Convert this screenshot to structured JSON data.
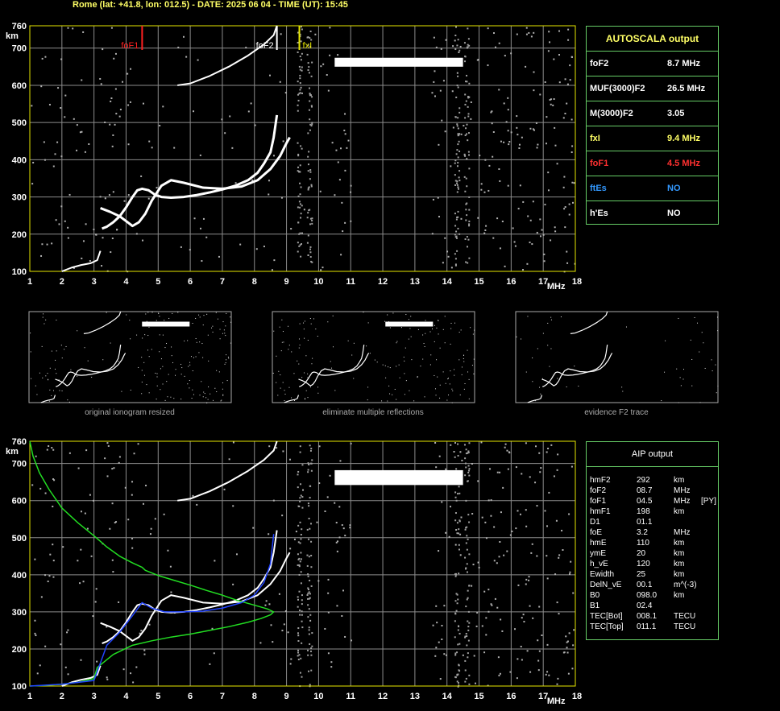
{
  "header": "Rome (lat: +41.8, lon: 012.5) - DATE: 2025 06 04 - TIME (UT): 15:45",
  "colors": {
    "axis": "#e6e600",
    "grid": "#8c8c8c",
    "trace": "#ffffff",
    "foF1_marker": "#ff2020",
    "fxI_marker": "#e6e600",
    "model_profile": "#22dd22",
    "aip_fit": "#2244ff",
    "label_yellow": "#ffff66",
    "label_red": "#ff3030",
    "label_blue": "#3399ff",
    "panel_border": "#66cc66"
  },
  "axes": {
    "ylabel": "km",
    "xlabel": "MHz",
    "x_ticks": [
      "1",
      "2",
      "3",
      "4",
      "5",
      "6",
      "7",
      "8",
      "9",
      "10",
      "11",
      "12",
      "13",
      "14",
      "15",
      "16",
      "17",
      "18"
    ],
    "y_ticks": [
      "100",
      "200",
      "300",
      "400",
      "500",
      "600",
      "700",
      "760"
    ]
  },
  "chart_data": [
    {
      "type": "scatter",
      "panel": "top-ionogram",
      "xlim": [
        1,
        18
      ],
      "ylim": [
        100,
        760
      ],
      "grid": true,
      "markers": [
        {
          "label": "foF1",
          "x": 4.5,
          "color": "#ff2020"
        },
        {
          "label": "foF2",
          "x": 8.7,
          "color": "#ffffff"
        },
        {
          "label": "fxI",
          "x": 9.4,
          "color": "#e6e600"
        }
      ],
      "series": [
        {
          "trace": "O-mode F2",
          "x": [
            3.25,
            3.4,
            3.6,
            3.8,
            4.0,
            4.2,
            4.35,
            4.5,
            4.7,
            4.9,
            5.1,
            5.4,
            5.8,
            6.2,
            6.6,
            7.0,
            7.4,
            7.8,
            8.1,
            8.3,
            8.5,
            8.6,
            8.7
          ],
          "y": [
            215,
            220,
            232,
            248,
            272,
            300,
            318,
            322,
            318,
            306,
            300,
            298,
            300,
            305,
            312,
            320,
            330,
            345,
            365,
            390,
            420,
            460,
            520
          ]
        },
        {
          "trace": "X-mode F2",
          "x": [
            3.2,
            3.5,
            3.8,
            4.0,
            4.2,
            4.4,
            4.6,
            4.8,
            5.1,
            5.4,
            5.8,
            6.4,
            7.0,
            7.6,
            8.1,
            8.5,
            8.8,
            9.0,
            9.1
          ],
          "y": [
            270,
            260,
            248,
            235,
            222,
            232,
            255,
            290,
            330,
            345,
            338,
            325,
            322,
            328,
            345,
            375,
            410,
            445,
            460
          ]
        },
        {
          "trace": "E-region",
          "x": [
            2.0,
            2.3,
            2.6,
            2.9,
            3.1,
            3.2
          ],
          "y": [
            100,
            110,
            117,
            122,
            130,
            155
          ]
        },
        {
          "trace": "multiple reflection",
          "x": [
            5.6,
            6.0,
            6.6,
            7.2,
            7.8,
            8.3,
            8.6,
            8.7
          ],
          "y": [
            600,
            605,
            625,
            650,
            680,
            710,
            735,
            760
          ]
        },
        {
          "trace": "sporadic band",
          "x": [
            10.5,
            14.5
          ],
          "y": [
            662,
            662
          ]
        }
      ]
    },
    {
      "type": "scatter",
      "panel": "bottom-ionogram-aip",
      "xlim": [
        1,
        18
      ],
      "ylim": [
        100,
        760
      ],
      "grid": true,
      "series": [
        {
          "trace": "model profile (green)",
          "x": [
            1.0,
            1.1,
            1.3,
            1.6,
            2.0,
            2.5,
            3.0,
            3.4,
            3.8,
            4.2,
            4.5,
            4.6,
            5.0,
            5.5,
            6.0,
            6.5,
            7.0,
            7.5,
            8.0,
            8.4,
            8.6,
            8.5,
            8.2,
            7.8,
            7.2,
            6.6,
            6.0,
            5.4,
            4.8,
            4.2,
            3.6,
            3.1,
            3.0,
            2.5,
            2.0,
            1.5,
            1.0
          ],
          "y": [
            760,
            720,
            675,
            630,
            580,
            540,
            505,
            475,
            450,
            432,
            420,
            412,
            398,
            385,
            372,
            358,
            345,
            330,
            318,
            308,
            300,
            292,
            282,
            272,
            260,
            250,
            240,
            232,
            222,
            210,
            185,
            150,
            120,
            110,
            105,
            102,
            100
          ]
        },
        {
          "trace": "AIP fit (blue)",
          "x": [
            1.0,
            2.0,
            3.0,
            3.4,
            3.8,
            4.2,
            4.5,
            4.8,
            5.2,
            5.8,
            6.4,
            7.0,
            7.6,
            8.0,
            8.3,
            8.5,
            8.6
          ],
          "y": [
            100,
            105,
            115,
            210,
            245,
            290,
            325,
            310,
            300,
            300,
            302,
            310,
            325,
            345,
            380,
            430,
            510
          ]
        }
      ]
    }
  ],
  "autoscala": {
    "title": "AUTOSCALA output",
    "rows": [
      {
        "label": "foF2",
        "value": "8.7 MHz",
        "color": "#ffffff"
      },
      {
        "label": "MUF(3000)F2",
        "value": "26.5 MHz",
        "color": "#ffffff"
      },
      {
        "label": "M(3000)F2",
        "value": "3.05",
        "color": "#ffffff"
      },
      {
        "label": "fxI",
        "value": "9.4 MHz",
        "color": "#ffff66"
      },
      {
        "label": "foF1",
        "value": "4.5 MHz",
        "color": "#ff3030"
      },
      {
        "label": "ftEs",
        "value": "NO",
        "color": "#3399ff"
      },
      {
        "label": "h'Es",
        "value": "NO",
        "color": "#ffffff"
      }
    ]
  },
  "aip": {
    "title": "AIP output",
    "rows": [
      {
        "name": "hmF2",
        "value": "292",
        "unit": "km",
        "extra": ""
      },
      {
        "name": "foF2",
        "value": "08.7",
        "unit": "MHz",
        "extra": ""
      },
      {
        "name": "foF1",
        "value": "04.5",
        "unit": "MHz",
        "extra": "[PY]"
      },
      {
        "name": "hmF1",
        "value": "198",
        "unit": "km",
        "extra": ""
      },
      {
        "name": "D1",
        "value": "01.1",
        "unit": "",
        "extra": ""
      },
      {
        "name": "foE",
        "value": "3.2",
        "unit": "MHz",
        "extra": ""
      },
      {
        "name": "hmE",
        "value": "110",
        "unit": "km",
        "extra": ""
      },
      {
        "name": "ymE",
        "value": "20",
        "unit": "km",
        "extra": ""
      },
      {
        "name": "h_vE",
        "value": "120",
        "unit": "km",
        "extra": ""
      },
      {
        "name": "Ewidth",
        "value": "25",
        "unit": "km",
        "extra": ""
      },
      {
        "name": "DelN_vE",
        "value": "00.1",
        "unit": "m^(-3)",
        "extra": ""
      },
      {
        "name": "B0",
        "value": "098.0",
        "unit": "km",
        "extra": ""
      },
      {
        "name": "B1",
        "value": "02.4",
        "unit": "",
        "extra": ""
      },
      {
        "name": "TEC[Bot]",
        "value": "008.1",
        "unit": "TECU",
        "extra": ""
      },
      {
        "name": "TEC[Top]",
        "value": "011.1",
        "unit": "TECU",
        "extra": ""
      }
    ]
  },
  "thumbnails": [
    {
      "caption": "original ionogram resized"
    },
    {
      "caption": "eliminate multiple reflections"
    },
    {
      "caption": "evidence F2 trace"
    }
  ]
}
